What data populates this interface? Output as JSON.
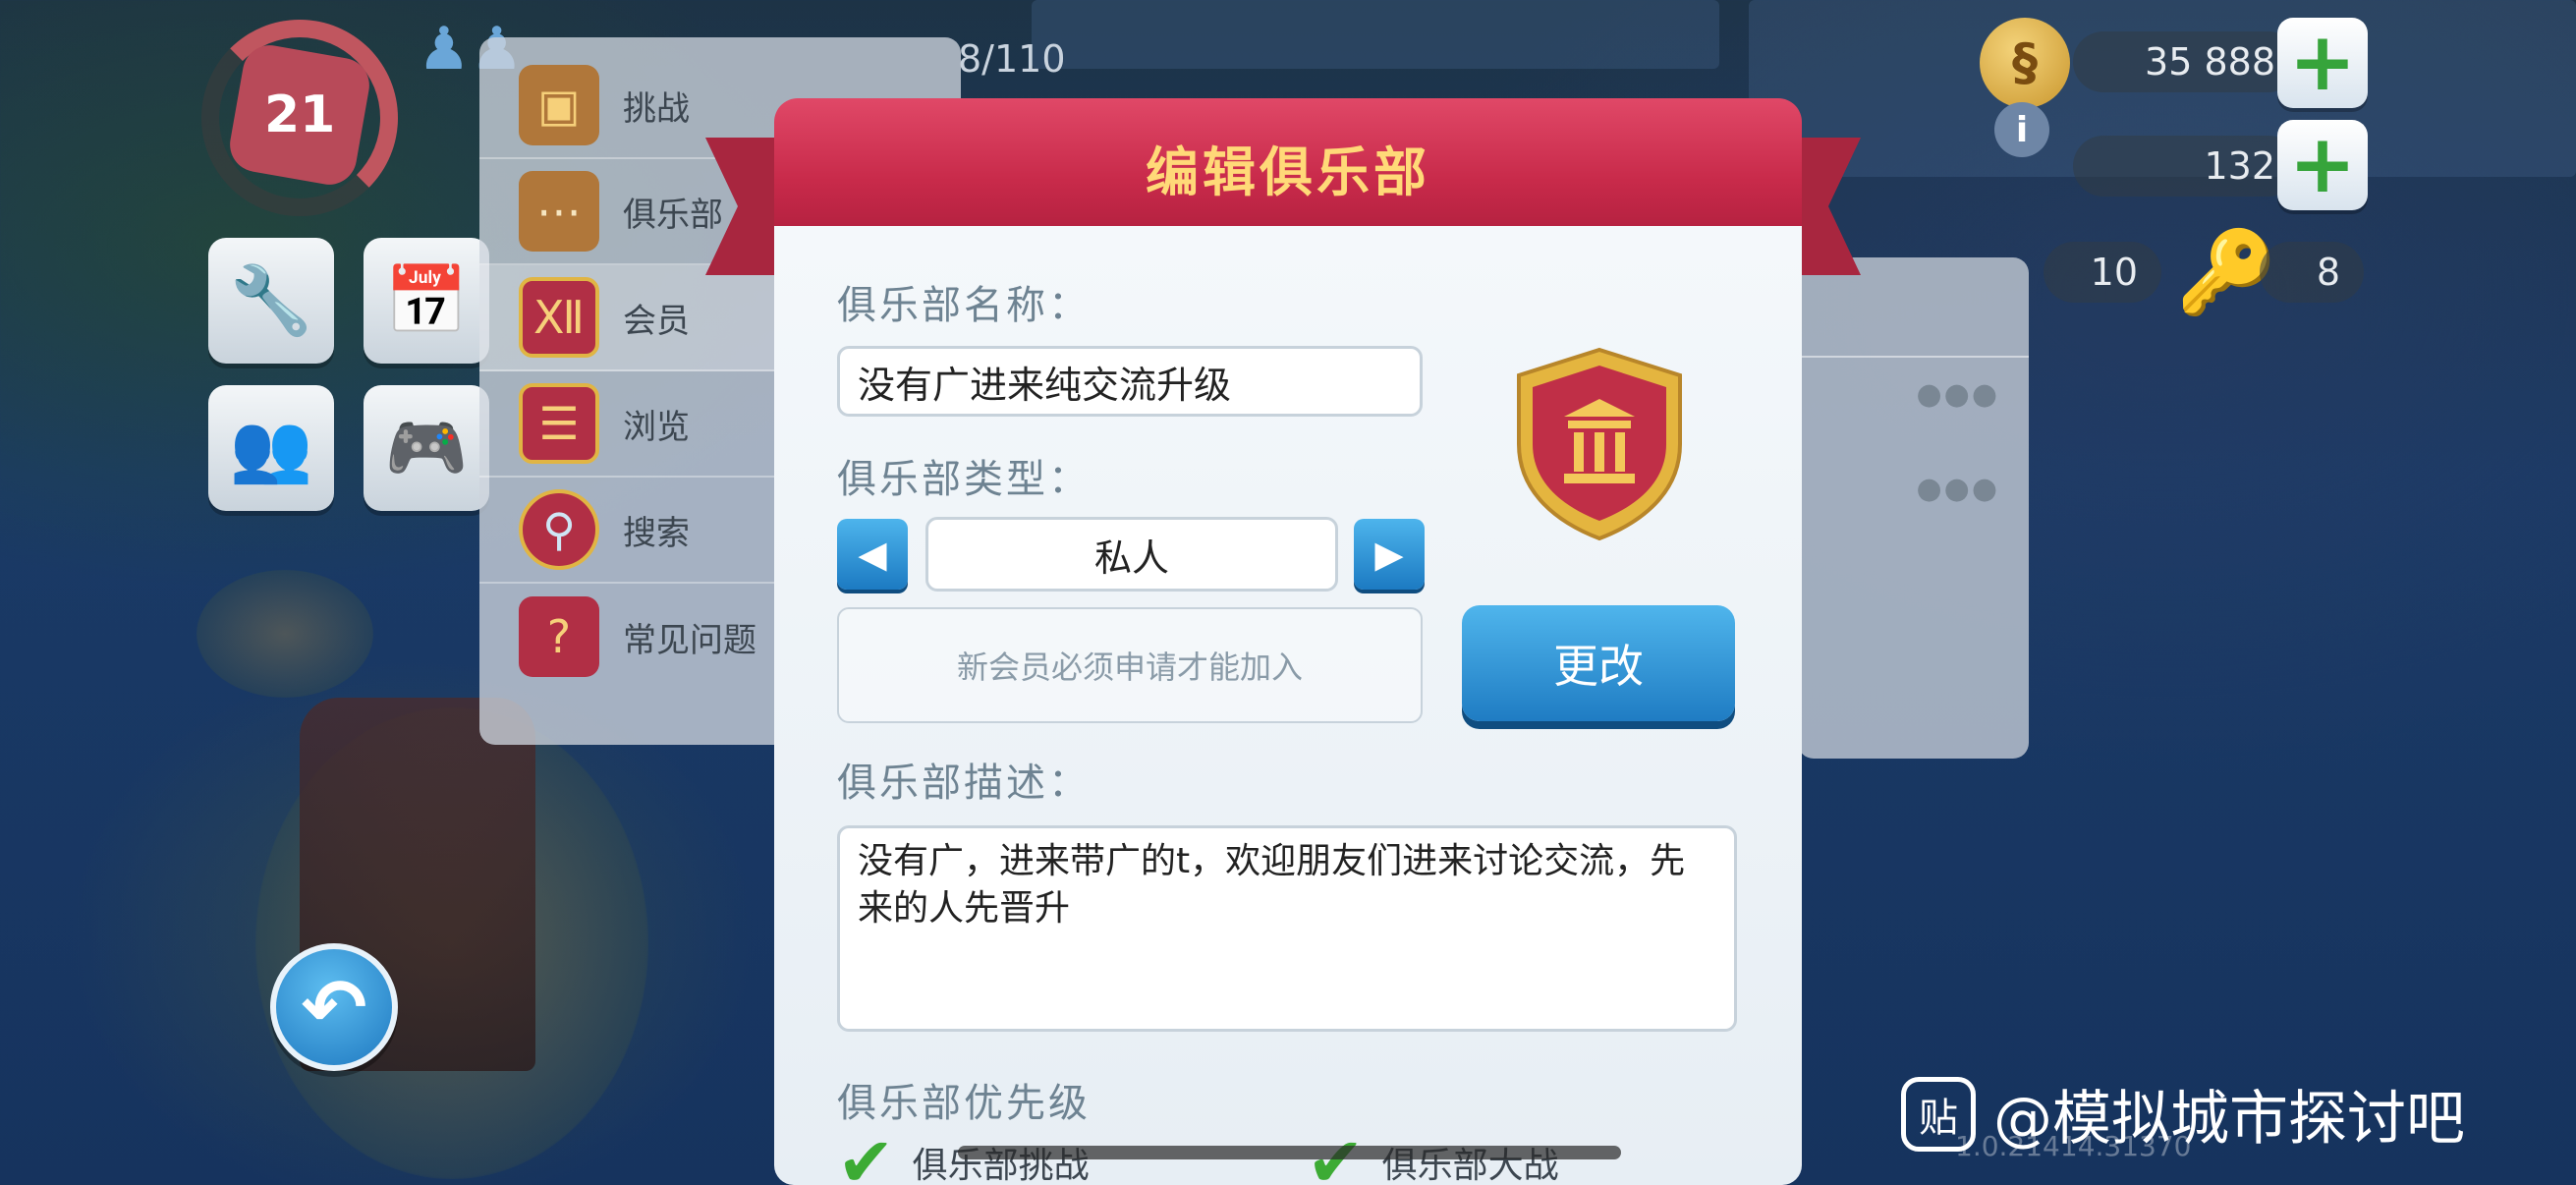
{
  "hud": {
    "level": "21",
    "population": "8/110",
    "simoleons": "35 888",
    "simcash": "132",
    "golden_keys": "10",
    "keys": "8",
    "version": "1.0.21414.31370"
  },
  "menu": {
    "items": [
      {
        "label": "挑战",
        "icon": "treasure-chest-icon"
      },
      {
        "label": "俱乐部",
        "icon": "chat-bubble-icon"
      },
      {
        "label": "会员",
        "icon": "club-shield-icon"
      },
      {
        "label": "浏览",
        "icon": "list-shield-icon"
      },
      {
        "label": "搜索",
        "icon": "magnifier-icon"
      },
      {
        "label": "常见问题",
        "icon": "faq-book-icon"
      }
    ]
  },
  "dialog": {
    "title": "编辑俱乐部",
    "name_label": "俱乐部名称：",
    "name_value": "没有广进来纯交流升级",
    "type_label": "俱乐部类型：",
    "type_value": "私人",
    "type_note": "新会员必须申请才能加入",
    "change_button": "更改",
    "desc_label": "俱乐部描述：",
    "desc_value": "没有广，进来带广的t，欢迎朋友们进来讨论交流，先来的人先晋升",
    "priority_label": "俱乐部优先级",
    "priorities": [
      "俱乐部挑战",
      "俱乐部大战"
    ]
  },
  "watermark": {
    "text": "@模拟城市探讨吧",
    "logo_char": "贴"
  },
  "colors": {
    "banner": "#c82a4a",
    "banner_title": "#ffd978",
    "button_blue": "#1f7cc3",
    "check_green": "#3cab34"
  }
}
